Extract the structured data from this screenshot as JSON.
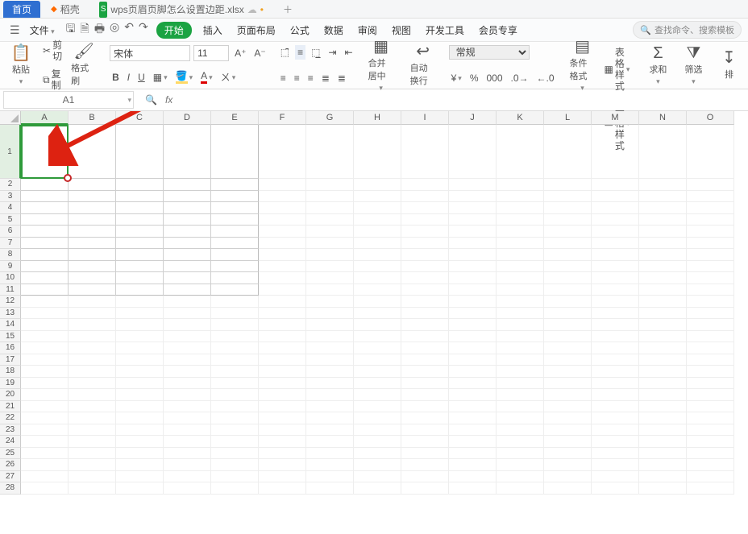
{
  "tabs": {
    "home": "首页",
    "daoke": "稻壳",
    "file": "wps页眉页脚怎么设置边距.xlsx"
  },
  "menubar": {
    "file": "文件",
    "search_placeholder": "查找命令、搜索模板"
  },
  "menus": {
    "start": "开始",
    "insert": "插入",
    "layout": "页面布局",
    "formula": "公式",
    "data": "数据",
    "review": "审阅",
    "view": "视图",
    "dev": "开发工具",
    "member": "会员专享"
  },
  "ribbon": {
    "paste": "粘贴",
    "cut": "剪切",
    "copy": "复制",
    "format_painter": "格式刷",
    "font_name": "宋体",
    "font_size": "11",
    "merge": "合并居中",
    "wrap": "自动换行",
    "number_format": "常规",
    "cond_format": "条件格式",
    "table_style": "表格样式",
    "cell_style": "单元格样式",
    "sum": "求和",
    "filter": "筛选",
    "extra": "排"
  },
  "formula_bar": {
    "cell_ref": "A1"
  },
  "grid": {
    "cols": [
      "A",
      "B",
      "C",
      "D",
      "E",
      "F",
      "G",
      "H",
      "I",
      "J",
      "K",
      "L",
      "M",
      "N",
      "O"
    ],
    "rows": [
      "1",
      "2",
      "3",
      "4",
      "5",
      "6",
      "7",
      "8",
      "9",
      "10",
      "11",
      "12",
      "13",
      "14",
      "15",
      "16",
      "17",
      "18",
      "19",
      "20",
      "21",
      "22",
      "23",
      "24",
      "25",
      "26",
      "27",
      "28"
    ],
    "selected": "A1"
  }
}
